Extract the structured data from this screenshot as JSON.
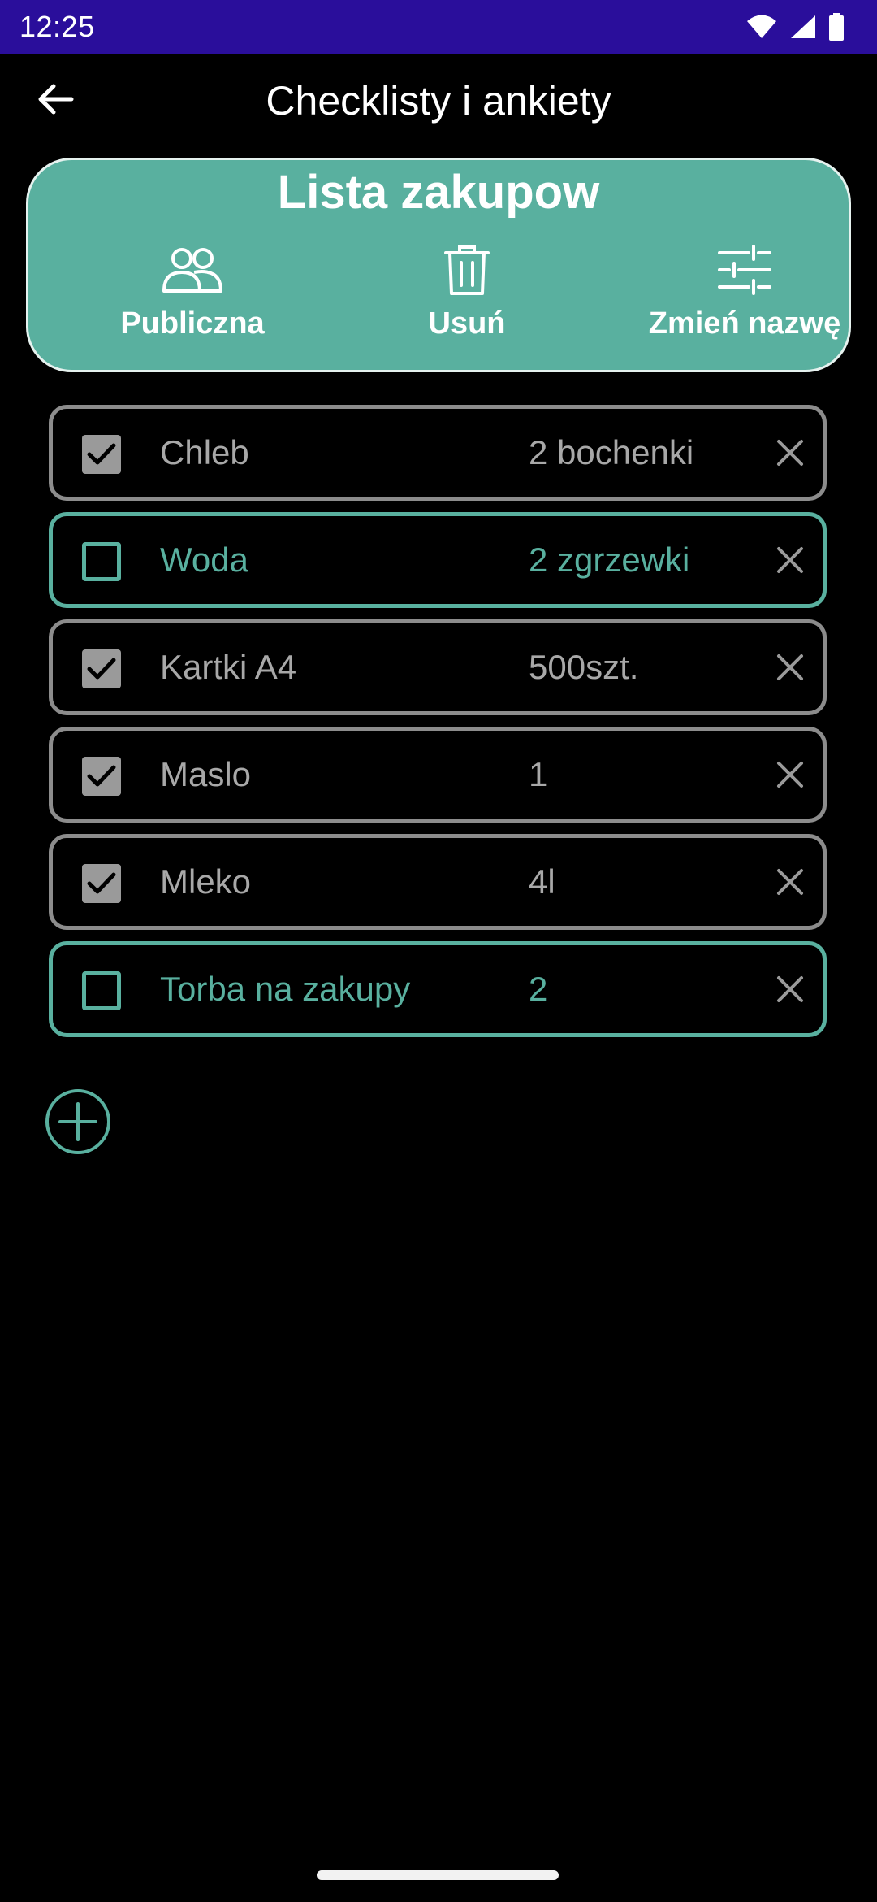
{
  "status_bar": {
    "time": "12:25",
    "icons": [
      "wifi-icon",
      "cell-signal-icon",
      "battery-icon"
    ]
  },
  "app_bar": {
    "title": "Checklisty i ankiety",
    "back_icon": "arrow-left-icon"
  },
  "card": {
    "title": "Lista zakupow",
    "actions": [
      {
        "label": "Publiczna",
        "icon": "people-icon"
      },
      {
        "label": "Usuń",
        "icon": "trash-icon"
      },
      {
        "label": "Zmień nazwę",
        "icon": "sliders-icon"
      }
    ]
  },
  "items": [
    {
      "name": "Chleb",
      "quantity": "2 bochenki",
      "checked": true
    },
    {
      "name": "Woda",
      "quantity": "2 zgrzewki",
      "checked": false
    },
    {
      "name": "Kartki A4",
      "quantity": "500szt.",
      "checked": true
    },
    {
      "name": "Maslo",
      "quantity": "1",
      "checked": true
    },
    {
      "name": "Mleko",
      "quantity": "4l",
      "checked": true
    },
    {
      "name": "Torba na zakupy",
      "quantity": "2",
      "checked": false
    }
  ],
  "add_button_icon": "plus-circle-icon",
  "colors": {
    "status_bar": "#2a0e9b",
    "accent": "#59b09f",
    "checked_border": "#8c8c8c",
    "checked_text": "#a8a8a8",
    "background": "#000000"
  }
}
